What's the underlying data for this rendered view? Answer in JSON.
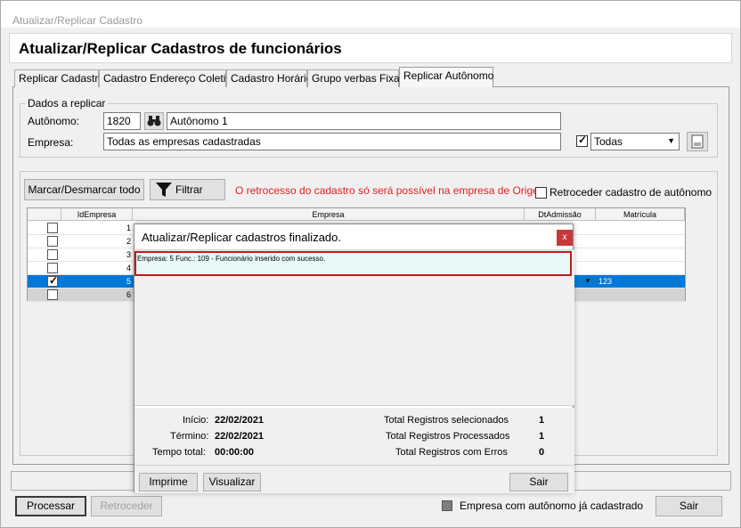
{
  "window": {
    "title": "Atualizar/Replicar Cadastro",
    "header": "Atualizar/Replicar Cadastros de funcionários"
  },
  "tabs": [
    {
      "label": "Replicar Cadastro"
    },
    {
      "label": "Cadastro Endereço Coletivo"
    },
    {
      "label": "Cadastro Horário"
    },
    {
      "label": "Grupo verbas Fixas"
    },
    {
      "label": "Replicar Autônomo"
    }
  ],
  "dados": {
    "title": "Dados a replicar",
    "autonomo_label": "Autônomo:",
    "autonomo_code": "1820",
    "autonomo_name": "Autônomo 1",
    "empresa_label": "Empresa:",
    "empresa_value": "Todas as empresas cadastradas",
    "filter_select": "Todas"
  },
  "toolbar": {
    "mark_button": "Marcar/Desmarcar todo",
    "filter_button": "Filtrar",
    "warning": "O retrocesso do cadastro só será possível na empresa de Origem",
    "retroceder_label": "Retroceder cadastro de autônomo"
  },
  "grid": {
    "columns": [
      "IdEmpresa",
      "Empresa",
      "DtAdmissão",
      "Matrícula"
    ],
    "rows": [
      {
        "id": "1",
        "checked": false,
        "matricula": ""
      },
      {
        "id": "2",
        "checked": false,
        "matricula": ""
      },
      {
        "id": "3",
        "checked": false,
        "matricula": ""
      },
      {
        "id": "4",
        "checked": false,
        "matricula": ""
      },
      {
        "id": "5",
        "checked": true,
        "matricula": "123"
      },
      {
        "id": "6",
        "checked": false,
        "matricula": ""
      }
    ]
  },
  "dialog": {
    "title": "Atualizar/Replicar cadastros finalizado.",
    "close": "x",
    "message": "Empresa: 5 Func.: 109 - Funcionário inserido com sucesso.",
    "inicio_label": "Início:",
    "inicio_value": "22/02/2021",
    "termino_label": "Término:",
    "termino_value": "22/02/2021",
    "tempo_label": "Tempo total:",
    "tempo_value": "00:00:00",
    "sel_label": "Total Registros selecionados",
    "sel_value": "1",
    "proc_label": "Total Registros Processados",
    "proc_value": "1",
    "err_label": "Total Registros com Erros",
    "err_value": "0",
    "imprime": "Imprime",
    "visualizar": "Visualizar",
    "sair": "Sair"
  },
  "footer": {
    "processar": "Processar",
    "retroceder": "Retroceder",
    "legend": "Empresa com autônomo já cadastrado",
    "sair": "Sair"
  }
}
